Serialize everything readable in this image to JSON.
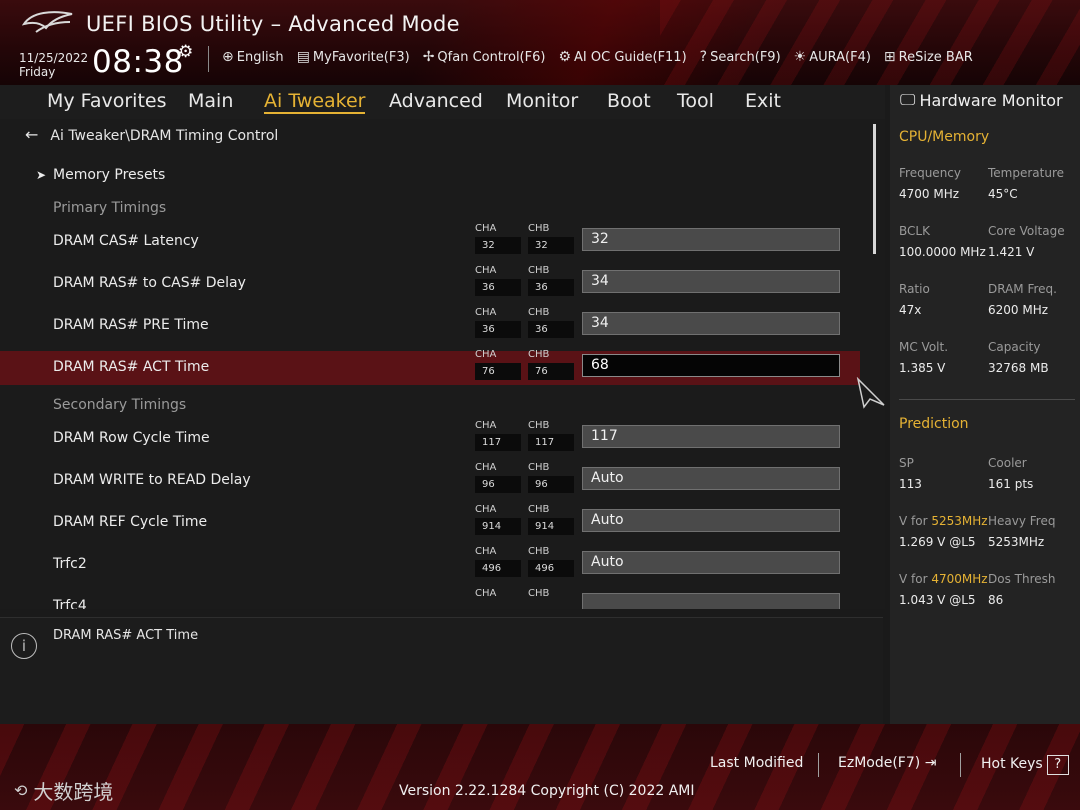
{
  "header": {
    "app_title": "UEFI BIOS Utility – Advanced Mode",
    "date": "11/25/2022",
    "weekday": "Friday",
    "time": "08:38",
    "toolbar": [
      {
        "icon": "globe-icon",
        "glyph": "⊕",
        "label": "English"
      },
      {
        "icon": "favorite-icon",
        "glyph": "▤",
        "label": "MyFavorite(F3)"
      },
      {
        "icon": "fan-icon",
        "glyph": "✢",
        "label": "Qfan Control(F6)"
      },
      {
        "icon": "ai-chip-icon",
        "glyph": "⚙",
        "label": "AI OC Guide(F11)"
      },
      {
        "icon": "search-help-icon",
        "glyph": "?",
        "label": "Search(F9)"
      },
      {
        "icon": "aura-light-icon",
        "glyph": "☀",
        "label": "AURA(F4)"
      },
      {
        "icon": "resize-bar-icon",
        "glyph": "⊞",
        "label": "ReSize BAR"
      }
    ]
  },
  "tabs": [
    {
      "label": "My Favorites",
      "active": false
    },
    {
      "label": "Main",
      "active": false
    },
    {
      "label": "Ai Tweaker",
      "active": true
    },
    {
      "label": "Advanced",
      "active": false
    },
    {
      "label": "Monitor",
      "active": false
    },
    {
      "label": "Boot",
      "active": false
    },
    {
      "label": "Tool",
      "active": false
    },
    {
      "label": "Exit",
      "active": false
    }
  ],
  "breadcrumb": "Ai Tweaker\\DRAM Timing Control",
  "channel_labels": {
    "a": "CHA",
    "b": "CHB"
  },
  "rows": [
    {
      "type": "submenu",
      "label": "Memory Presets"
    },
    {
      "type": "section",
      "label": "Primary Timings"
    },
    {
      "type": "setting",
      "label": "DRAM CAS# Latency",
      "cha": "32",
      "chb": "32",
      "value": "32"
    },
    {
      "type": "setting",
      "label": "DRAM RAS# to CAS# Delay",
      "cha": "36",
      "chb": "36",
      "value": "34"
    },
    {
      "type": "setting",
      "label": "DRAM RAS# PRE Time",
      "cha": "36",
      "chb": "36",
      "value": "34"
    },
    {
      "type": "setting",
      "label": "DRAM RAS# ACT Time",
      "cha": "76",
      "chb": "76",
      "value": "68",
      "selected": true
    },
    {
      "type": "section",
      "label": "Secondary Timings"
    },
    {
      "type": "setting",
      "label": "DRAM Row Cycle Time",
      "cha": "117",
      "chb": "117",
      "value": "117"
    },
    {
      "type": "setting",
      "label": "DRAM WRITE to READ Delay",
      "cha": "96",
      "chb": "96",
      "value": "Auto"
    },
    {
      "type": "setting",
      "label": "DRAM REF Cycle Time",
      "cha": "914",
      "chb": "914",
      "value": "Auto"
    },
    {
      "type": "setting",
      "label": "Trfc2",
      "cha": "496",
      "chb": "496",
      "value": "Auto"
    },
    {
      "type": "setting",
      "label": "Trfc4",
      "cha": "",
      "chb": "",
      "value": ""
    }
  ],
  "help": {
    "text": "DRAM RAS# ACT Time"
  },
  "hardware_monitor": {
    "title": "Hardware Monitor",
    "cpu_memory": {
      "title": "CPU/Memory",
      "items": [
        {
          "key": "Frequency",
          "value": "4700 MHz"
        },
        {
          "key": "Temperature",
          "value": "45°C"
        },
        {
          "key": "BCLK",
          "value": "100.0000 MHz"
        },
        {
          "key": "Core Voltage",
          "value": "1.421 V"
        },
        {
          "key": "Ratio",
          "value": "47x"
        },
        {
          "key": "DRAM Freq.",
          "value": "6200 MHz"
        },
        {
          "key": "MC Volt.",
          "value": "1.385 V"
        },
        {
          "key": "Capacity",
          "value": "32768 MB"
        }
      ]
    },
    "prediction": {
      "title": "Prediction",
      "sp_key": "SP",
      "sp_value": "113",
      "cooler_key": "Cooler",
      "cooler_value": "161 pts",
      "v1_prefix": "V for ",
      "v1_freq": "5253MHz",
      "v1_value": "1.269 V @L5",
      "heavy_key": "Heavy Freq",
      "heavy_value": "5253MHz",
      "v2_prefix": "V for ",
      "v2_freq": "4700MHz",
      "v2_value": "1.043 V @L5",
      "dos_key": "Dos Thresh",
      "dos_value": "86"
    }
  },
  "footer": {
    "last_modified": "Last Modified",
    "ezmode": "EzMode(F7)",
    "hot_keys": "Hot Keys",
    "hot_keys_glyph": "?",
    "version": "Version 2.22.1284 Copyright (C) 2022 AMI",
    "watermark": "大数跨境"
  },
  "colors": {
    "accent": "#e5b234",
    "selected_row": "#5a1216",
    "header_red": "#3a0b0d"
  }
}
